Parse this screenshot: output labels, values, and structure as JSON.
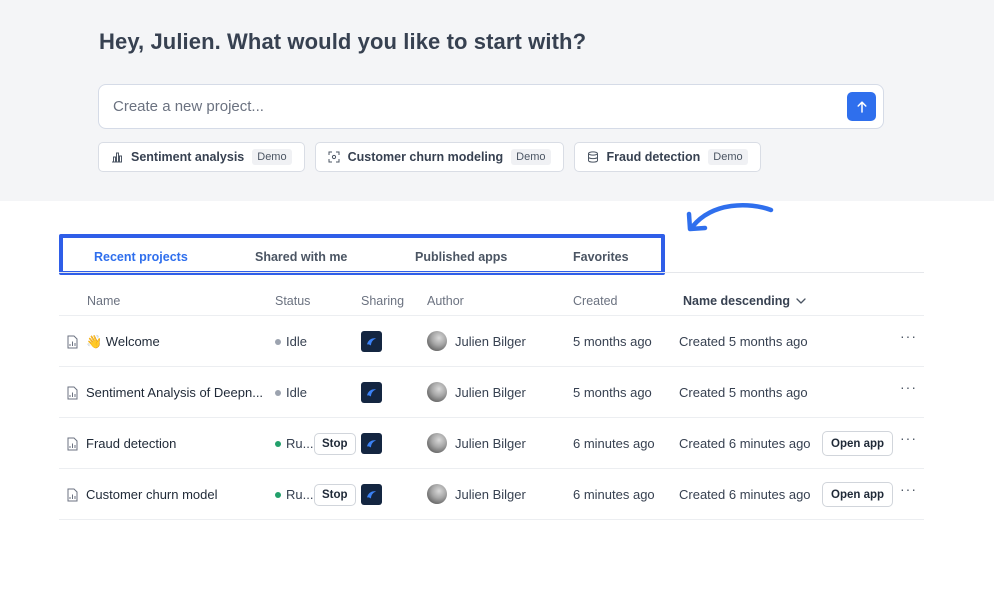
{
  "greeting": "Hey, Julien. What would you like to start with?",
  "prompt": {
    "placeholder": "Create a new project...",
    "value": ""
  },
  "suggestions": [
    {
      "label": "Sentiment analysis",
      "badge": "Demo",
      "icon": "bar-chart-icon"
    },
    {
      "label": "Customer churn modeling",
      "badge": "Demo",
      "icon": "scan-icon"
    },
    {
      "label": "Fraud detection",
      "badge": "Demo",
      "icon": "database-icon"
    }
  ],
  "tabs": [
    {
      "label": "Recent projects",
      "active": true
    },
    {
      "label": "Shared with me",
      "active": false
    },
    {
      "label": "Published apps",
      "active": false
    },
    {
      "label": "Favorites",
      "active": false
    }
  ],
  "table": {
    "headers": {
      "name": "Name",
      "status": "Status",
      "sharing": "Sharing",
      "author": "Author",
      "created": "Created",
      "sort": "Name descending"
    },
    "rows": [
      {
        "name": "👋 Welcome",
        "status": "Idle",
        "status_color": "#9ca3af",
        "author": "Julien Bilger",
        "created": "5 months ago",
        "created_desc": "Created 5 months ago"
      },
      {
        "name": "Sentiment Analysis of Deepn...",
        "status": "Idle",
        "status_color": "#9ca3af",
        "author": "Julien Bilger",
        "created": "5 months ago",
        "created_desc": "Created 5 months ago"
      },
      {
        "name": "Fraud detection",
        "status": "Ru...",
        "status_color": "#22a06b",
        "stop": "Stop",
        "author": "Julien Bilger",
        "created": "6 minutes ago",
        "created_desc": "Created 6 minutes ago",
        "open": "Open app"
      },
      {
        "name": "Customer churn model",
        "status": "Ru...",
        "status_color": "#22a06b",
        "stop": "Stop",
        "author": "Julien Bilger",
        "created": "6 minutes ago",
        "created_desc": "Created 6 minutes ago",
        "open": "Open app"
      }
    ],
    "more_glyph": "···"
  },
  "colors": {
    "accent": "#2f6fed",
    "highlight": "#2f5ee8",
    "running": "#22a06b",
    "idle": "#9ca3af"
  }
}
